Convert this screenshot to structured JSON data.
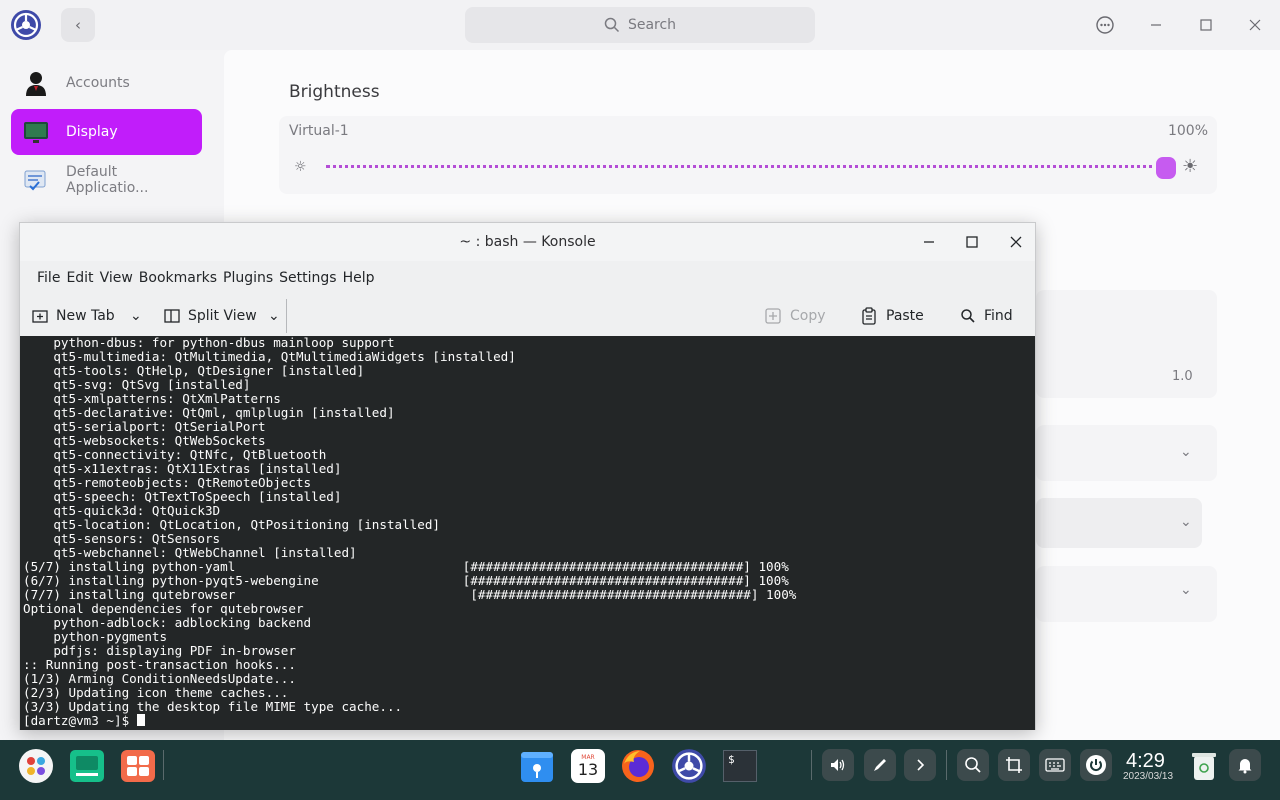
{
  "settings": {
    "search_placeholder": "Search",
    "sidebar": [
      {
        "label": "Accounts"
      },
      {
        "label": "Display"
      },
      {
        "label": "Default Applicatio..."
      }
    ],
    "section_title": "Brightness",
    "monitor_name": "Virtual-1",
    "brightness_value": "100%",
    "brightness_fraction": 1.0,
    "scale_value": "1.0",
    "accent_color": "#c11dfa"
  },
  "konsole": {
    "title": "~ : bash — Konsole",
    "menu": [
      "File",
      "Edit",
      "View",
      "Bookmarks",
      "Plugins",
      "Settings",
      "Help"
    ],
    "toolbar": {
      "new_tab": "New Tab",
      "split_view": "Split View",
      "copy": "Copy",
      "paste": "Paste",
      "find": "Find"
    },
    "lines": [
      "    python-dbus: for python-dbus mainloop support",
      "    qt5-multimedia: QtMultimedia, QtMultimediaWidgets [installed]",
      "    qt5-tools: QtHelp, QtDesigner [installed]",
      "    qt5-svg: QtSvg [installed]",
      "    qt5-xmlpatterns: QtXmlPatterns",
      "    qt5-declarative: QtQml, qmlplugin [installed]",
      "    qt5-serialport: QtSerialPort",
      "    qt5-websockets: QtWebSockets",
      "    qt5-connectivity: QtNfc, QtBluetooth",
      "    qt5-x11extras: QtX11Extras [installed]",
      "    qt5-remoteobjects: QtRemoteObjects",
      "    qt5-speech: QtTextToSpeech [installed]",
      "    qt5-quick3d: QtQuick3D",
      "    qt5-location: QtLocation, QtPositioning [installed]",
      "    qt5-sensors: QtSensors",
      "    qt5-webchannel: QtWebChannel [installed]",
      "(5/7) installing python-yaml                              [####################################] 100%",
      "(6/7) installing python-pyqt5-webengine                   [####################################] 100%",
      "(7/7) installing qutebrowser                               [####################################] 100%",
      "Optional dependencies for qutebrowser",
      "    python-adblock: adblocking backend",
      "    python-pygments",
      "    pdfjs: displaying PDF in-browser",
      ":: Running post-transaction hooks...",
      "(1/3) Arming ConditionNeedsUpdate...",
      "(2/3) Updating icon theme caches...",
      "(3/3) Updating the desktop file MIME type cache..."
    ],
    "prompt": "[dartz@vm3 ~]$ "
  },
  "dock": {
    "calendar_month": "MAR",
    "calendar_day": "13",
    "terminal_glyph": "$",
    "clock_time": "4:29",
    "clock_date": "2023/03/13"
  }
}
